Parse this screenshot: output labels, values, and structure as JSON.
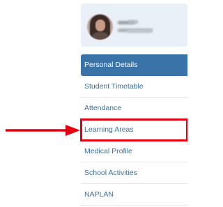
{
  "profile": {
    "name_blurred": "",
    "subtitle_blurred": ""
  },
  "nav": {
    "items": [
      {
        "label": "Personal Details",
        "state": "active"
      },
      {
        "label": "Student Timetable",
        "state": "normal"
      },
      {
        "label": "Attendance",
        "state": "normal"
      },
      {
        "label": "Learning Areas",
        "state": "highlighted"
      },
      {
        "label": "Medical Profile",
        "state": "normal"
      },
      {
        "label": "School Activities",
        "state": "normal"
      },
      {
        "label": "NAPLAN",
        "state": "normal"
      }
    ]
  },
  "annotation": {
    "arrow_color": "#e3000f",
    "highlight_color": "#e3000f",
    "target": "Learning Areas"
  },
  "colors": {
    "active_bg": "#3a73a8",
    "link_text": "#3b6e99",
    "card_bg": "#e9f0f7"
  }
}
